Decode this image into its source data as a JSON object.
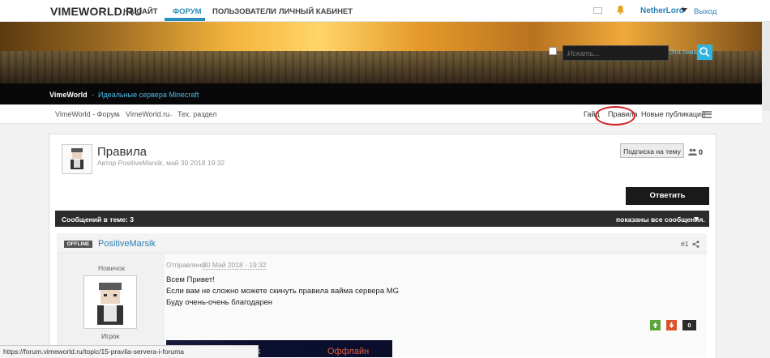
{
  "site": {
    "logo": "VIMEWORLD.RU"
  },
  "nav": {
    "items": [
      {
        "label": "НА САЙТ"
      },
      {
        "label": "ФОРУМ",
        "active": true
      },
      {
        "label": "ПОЛЬЗОВАТЕЛИ"
      },
      {
        "label": "ЛИЧНЫЙ КАБИНЕТ"
      }
    ],
    "user": "NetherLord",
    "logout": "Выход"
  },
  "search": {
    "placeholder": "Искать...",
    "scope": "Эта тема"
  },
  "brandbar": {
    "name": "VimeWorld",
    "separator": "-",
    "tagline": "Идеальные сервера Minecraft"
  },
  "breadcrumb": {
    "items": [
      "VimeWorld - Форум",
      "VimeWorld.ru",
      "Тех. раздел"
    ],
    "arrow": "→"
  },
  "quicklinks": {
    "guides": "Гайд",
    "rules": "Правила",
    "new_posts": "Новые публикации"
  },
  "topic": {
    "title": "Правила",
    "byline": "Автор PositiveMarsik, май 30 2018 19:32",
    "subscribe": "Подписка на тему",
    "followers": "0",
    "reply": "Ответить"
  },
  "messages_bar": {
    "count_label": "Сообщений в теме: 3",
    "show_all": "показаны все сообщения."
  },
  "post": {
    "status": "OFFLINE",
    "author": "PositiveMarsik",
    "number": "#1",
    "rank": "Новичок",
    "group": "Игрок",
    "posted_label": "Отправлено",
    "posted_date": "30 Май 2018 - 19:32",
    "lines": [
      "Всем Привет!",
      "Если вам не сложно можете скинуть правила вайма сервера MG",
      "Буду очень-очень благодарен"
    ],
    "score": "0",
    "signature_text_left": "k",
    "signature_text_right": "Оффлайн"
  },
  "statusbar": {
    "url": "https://forum.vimeworld.ru/topic/15-pravila-servera-i-foruma"
  },
  "colors": {
    "accent": "#2a8fb8",
    "link": "#2a7fb5",
    "dark": "#080808",
    "annotation": "#d42222"
  }
}
